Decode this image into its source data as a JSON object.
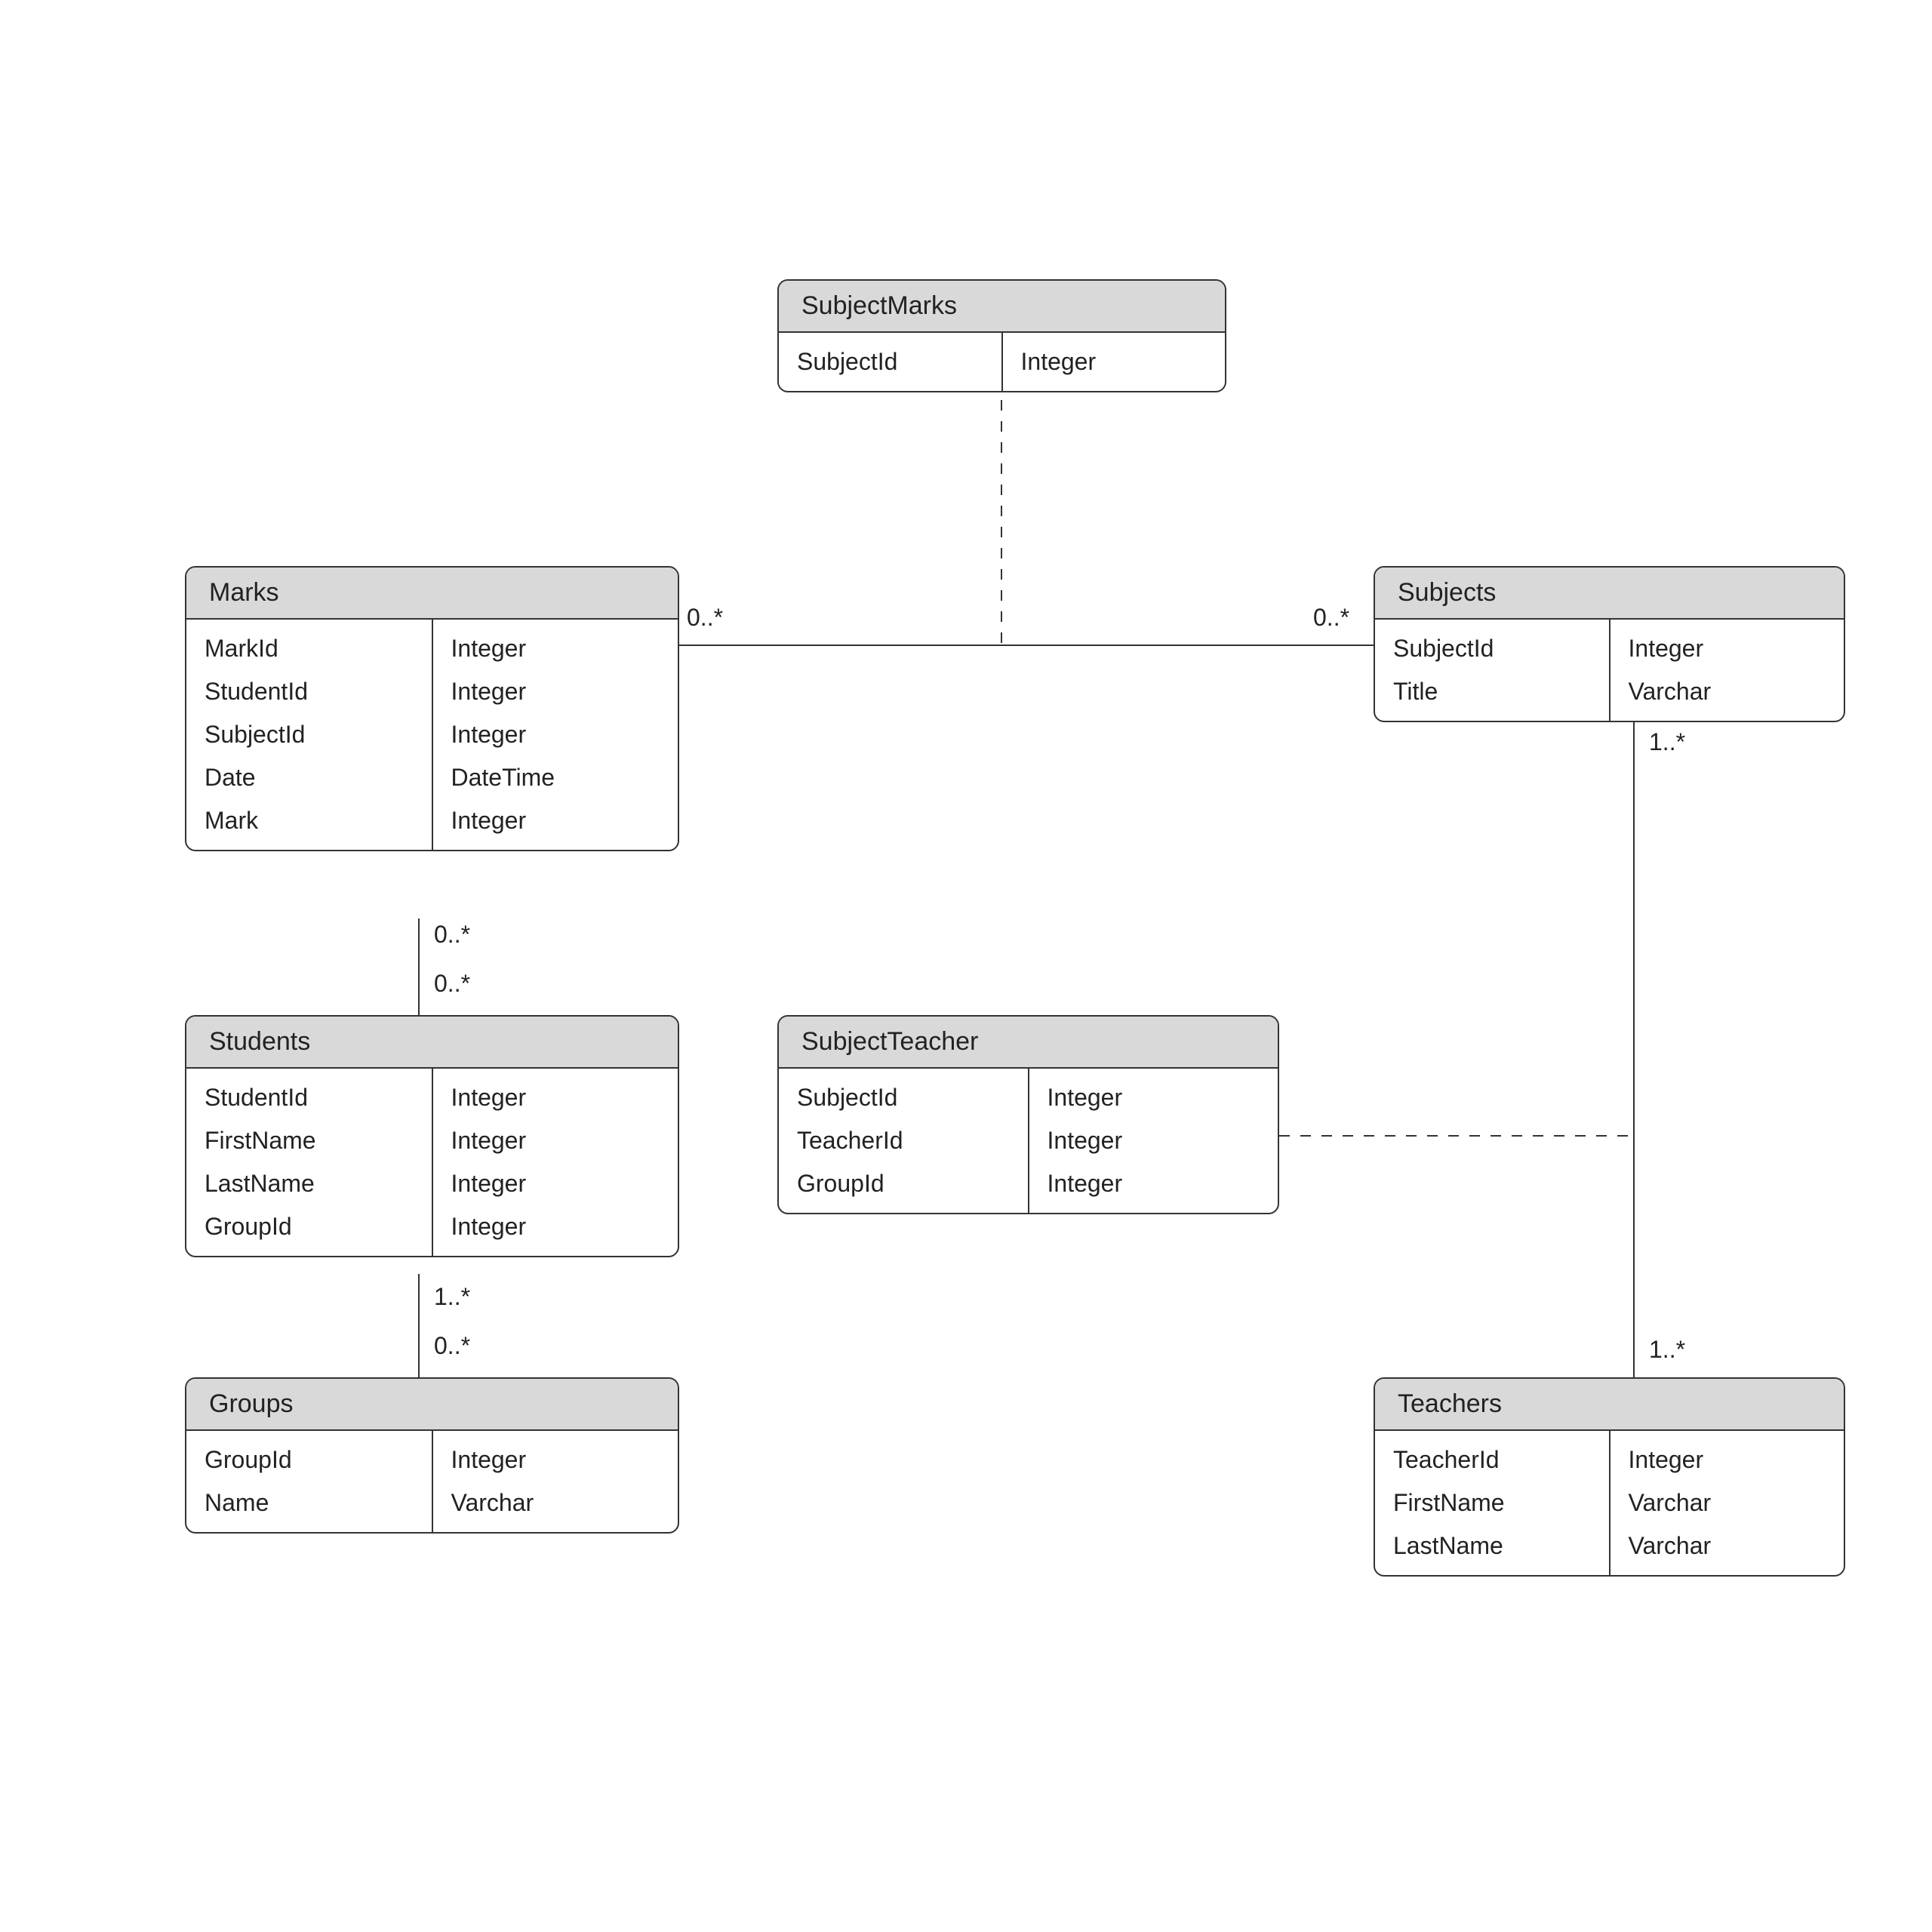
{
  "entities": {
    "subjectMarks": {
      "title": "SubjectMarks",
      "rows": [
        {
          "name": "SubjectId",
          "type": "Integer"
        }
      ]
    },
    "marks": {
      "title": "Marks",
      "rows": [
        {
          "name": "MarkId",
          "type": "Integer"
        },
        {
          "name": "StudentId",
          "type": "Integer"
        },
        {
          "name": "SubjectId",
          "type": "Integer"
        },
        {
          "name": "Date",
          "type": "DateTime"
        },
        {
          "name": "Mark",
          "type": "Integer"
        }
      ]
    },
    "subjects": {
      "title": "Subjects",
      "rows": [
        {
          "name": "SubjectId",
          "type": "Integer"
        },
        {
          "name": "Title",
          "type": "Varchar"
        }
      ]
    },
    "students": {
      "title": "Students",
      "rows": [
        {
          "name": "StudentId",
          "type": "Integer"
        },
        {
          "name": "FirstName",
          "type": "Integer"
        },
        {
          "name": "LastName",
          "type": "Integer"
        },
        {
          "name": "GroupId",
          "type": "Integer"
        }
      ]
    },
    "subjectTeacher": {
      "title": "SubjectTeacher",
      "rows": [
        {
          "name": "SubjectId",
          "type": "Integer"
        },
        {
          "name": "TeacherId",
          "type": "Integer"
        },
        {
          "name": "GroupId",
          "type": "Integer"
        }
      ]
    },
    "groups": {
      "title": "Groups",
      "rows": [
        {
          "name": "GroupId",
          "type": "Integer"
        },
        {
          "name": "Name",
          "type": "Varchar"
        }
      ]
    },
    "teachers": {
      "title": "Teachers",
      "rows": [
        {
          "name": "TeacherId",
          "type": "Integer"
        },
        {
          "name": "FirstName",
          "type": "Varchar"
        },
        {
          "name": "LastName",
          "type": "Varchar"
        }
      ]
    }
  },
  "cardinalities": {
    "marksSubjects_left": "0..*",
    "marksSubjects_right": "0..*",
    "marksStudents_top": "0..*",
    "marksStudents_bottom": "0..*",
    "studentsGroups_top": "1..*",
    "studentsGroups_bottom": "0..*",
    "subjectsTeachers_top": "1..*",
    "subjectsTeachers_bottom": "1..*"
  }
}
